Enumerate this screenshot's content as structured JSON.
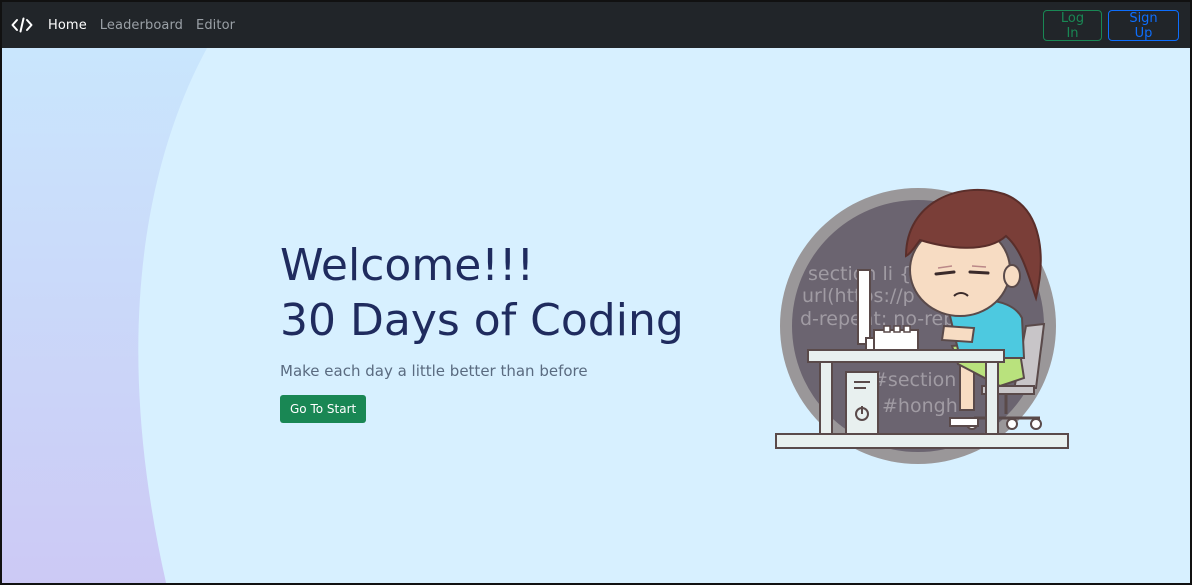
{
  "navbar": {
    "brand_icon": "code-icon",
    "links": [
      {
        "label": "Home",
        "active": true
      },
      {
        "label": "Leaderboard",
        "active": false
      },
      {
        "label": "Editor",
        "active": false
      }
    ],
    "login_label": "Log In",
    "signup_label": "Sign Up"
  },
  "hero": {
    "title_line1": "Welcome!!!",
    "title_line2": "30 Days of Coding",
    "subtitle": "Make each day a little better than before",
    "cta_label": "Go To Start"
  },
  "illustration": {
    "code_lines": [
      "section li {",
      "url(https://p",
      "d-repeat: no-repe",
      "#section",
      "#hongh"
    ]
  },
  "colors": {
    "navbar_bg": "#212529",
    "page_bg": "#d7f0ff",
    "login": "#198754",
    "signup": "#0d6efd",
    "cta": "#198754",
    "title": "#1f2b5e"
  }
}
